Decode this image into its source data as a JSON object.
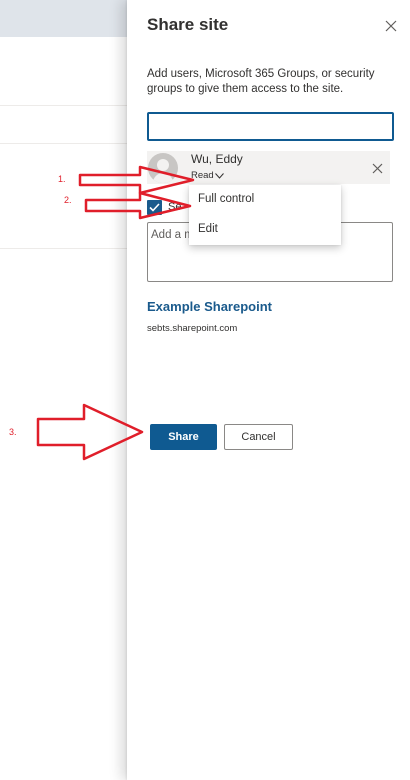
{
  "panel": {
    "title": "Share site",
    "description": "Add users, Microsoft 365 Groups, or security groups to give them access to the site.",
    "search": {
      "value": "",
      "placeholder": ""
    },
    "user": {
      "name": "Wu, Eddy",
      "permission": "Read"
    },
    "send_email": {
      "checked": true,
      "label": "Se"
    },
    "message": {
      "value": "",
      "placeholder": "Add a message"
    },
    "site": {
      "name": "Example Sharepoint",
      "url": "sebts.sharepoint.com"
    },
    "buttons": {
      "share": "Share",
      "cancel": "Cancel"
    }
  },
  "permission_menu": {
    "items": [
      "Full control",
      "Edit"
    ]
  },
  "annotations": {
    "labels": [
      "1.",
      "2.",
      "3."
    ],
    "color": "#e01e2a"
  },
  "colors": {
    "accent": "#0f5a91",
    "link": "#1a5a8c",
    "chip_bg": "#f3f2f1"
  },
  "icons": [
    "close-icon",
    "person-icon",
    "chevron-down-icon",
    "checkmark-icon"
  ]
}
